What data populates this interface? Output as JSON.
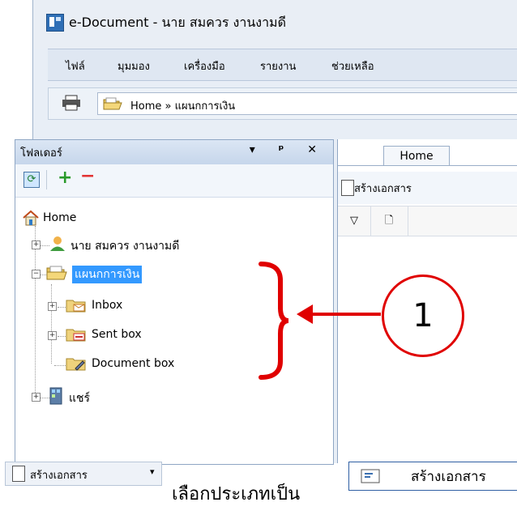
{
  "window": {
    "title": "e-Document - นาย สมควร งานงามดี"
  },
  "menu": [
    "ไฟล์",
    "มุมมอง",
    "เครื่องมือ",
    "รายงาน",
    "ช่วยเหลือ"
  ],
  "address": {
    "text": "Home » แผนกการเงิน"
  },
  "folder_pane": {
    "title": "โฟลเดอร์",
    "controls": "▾ ᵖ ✕",
    "tree": {
      "root": "Home",
      "user": "นาย สมควร งานงามดี",
      "dept": "แผนกการเงิน",
      "inbox": "Inbox",
      "sent": "Sent box",
      "docbox": "Document box",
      "share": "แชร์"
    }
  },
  "content_pane": {
    "tab": "Home",
    "create_label": "สร้างเอกสาร",
    "grid_icons": [
      "▽",
      "🗋"
    ]
  },
  "annotation": {
    "number": "1"
  },
  "legend": {
    "button_label": "สร้างเอกสาร",
    "caret": "▾",
    "choose_text": "เลือกประเภทเป็น",
    "type_label": "สร้างเอกสาร"
  },
  "colors": {
    "accent_red": "#e00000",
    "selection": "#3399ff"
  }
}
